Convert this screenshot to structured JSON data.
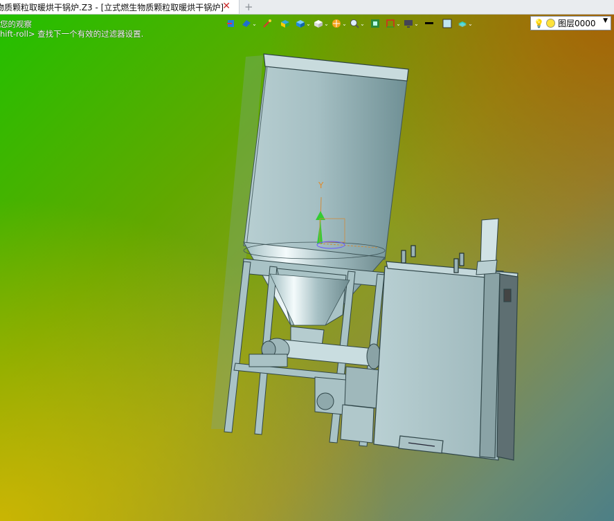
{
  "tab": {
    "title": "物质颗粒取暖烘干锅炉.Z3 - [立式燃生物质颗粒取暖烘干锅炉]",
    "close_icon": "close-icon",
    "add_icon": "plus-icon"
  },
  "hints": {
    "line1": "您的观察",
    "line2": "hift-roll> 查找下一个有效的过滤器设置."
  },
  "toolbar": {
    "items": [
      "exit-icon",
      "view-icon",
      "pencil-icon",
      "cube-color-icon",
      "cube-icon",
      "cube-white-icon",
      "render-icon",
      "zoom-icon",
      "fit-icon",
      "frame-icon",
      "monitor-icon"
    ]
  },
  "layer": {
    "label": "图层0000"
  },
  "axis": {
    "y_label": "Y"
  },
  "colors": {
    "accent_close": "#cc2a2a",
    "bg_top_left": "#22c000",
    "bg_bottom_right": "#4d7f86"
  }
}
